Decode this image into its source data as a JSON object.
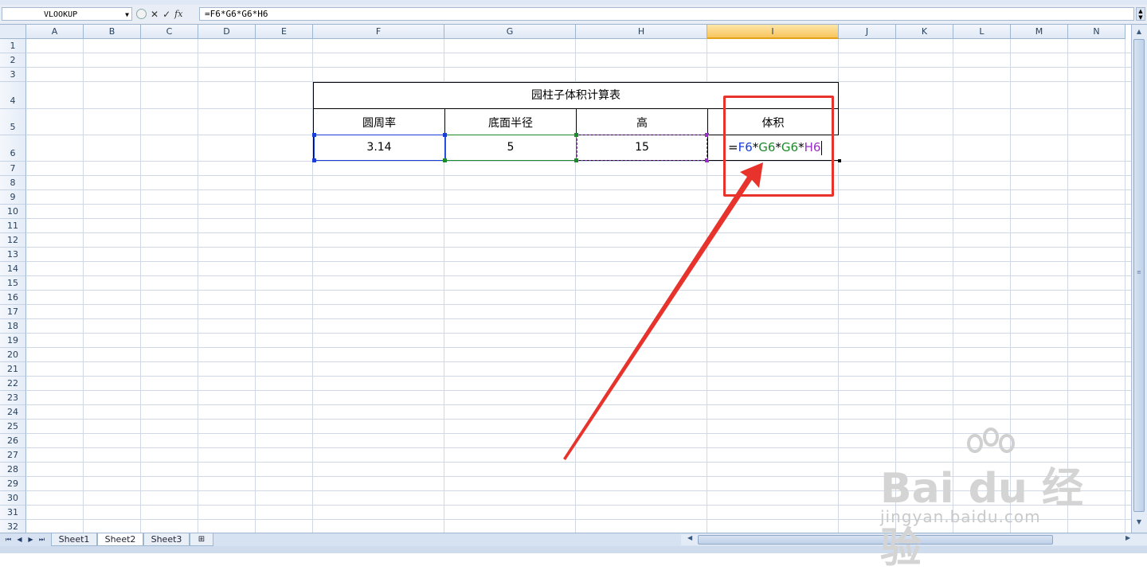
{
  "formula_bar": {
    "name_box": "VLOOKUP",
    "fx_label": "fx",
    "formula": "=F6*G6*G6*H6"
  },
  "columns": [
    "A",
    "B",
    "C",
    "D",
    "E",
    "F",
    "G",
    "H",
    "I",
    "J",
    "K",
    "L",
    "M",
    "N"
  ],
  "active_column": "I",
  "rows": [
    "1",
    "2",
    "3",
    "4",
    "5",
    "6",
    "7",
    "8",
    "9",
    "10",
    "11",
    "12",
    "13",
    "14",
    "15",
    "16",
    "17",
    "18",
    "19",
    "20",
    "21",
    "22",
    "23",
    "24",
    "25",
    "26",
    "27",
    "28",
    "29",
    "30",
    "31",
    "32"
  ],
  "table": {
    "title": "园柱子体积计算表",
    "headers": [
      "圆周率",
      "底面半径",
      "高",
      "体积"
    ],
    "values": [
      "3.14",
      "5",
      "15"
    ],
    "editing_formula": {
      "eq": "=",
      "r1": "F6",
      "op1": "*",
      "r2": "G6",
      "op2": "*",
      "r3": "G6",
      "op3": "*",
      "r4": "H6"
    }
  },
  "ref_colors": {
    "F6": "#1a3fd6",
    "G6": "#1d8a2a",
    "H6": "#9b2fc4"
  },
  "annotation_color": "#e8332c",
  "sheet_tabs": [
    "Sheet1",
    "Sheet2",
    "Sheet3"
  ],
  "active_sheet": "Sheet2",
  "watermark": {
    "brand": "Bai du 经验",
    "url": "jingyan.baidu.com"
  }
}
